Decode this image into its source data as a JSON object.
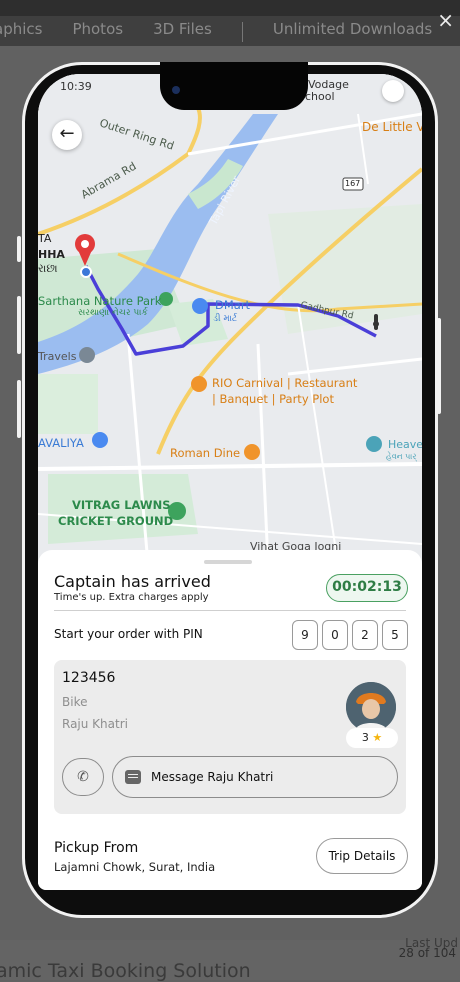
{
  "background_page": {
    "tabs": [
      "aphics",
      "Photos",
      "3D Files",
      "Unlimited Downloads"
    ],
    "close_symbol": "×",
    "counter": "28 of 104",
    "last_update": "Last Upd",
    "title_snippet": "amic Taxi Booking Solution"
  },
  "status": {
    "time": "10:39",
    "carrier_hint": "Vodage",
    "school_hint": "School"
  },
  "map": {
    "labels": {
      "outer_ring": "Outer Ring Rd",
      "abrama": "Abrama Rd",
      "tapi": "Tapi River",
      "de_little": "De Little V",
      "road_167": "167",
      "ta": "TA",
      "hha": "HHA",
      "guj_short": "રાછા",
      "park": "Sarthana Nature Park",
      "park_guj": "સરથાણા નેચર પાર્ક",
      "dmart": "DMart",
      "dmart_guj": "ડી માર્ટ",
      "gadhpur": "Gadhpur Rd",
      "travels": "Travels",
      "rio1": "RIO Carnival | Restaurant",
      "rio2": "| Banquet | Party Plot",
      "avaliya": "AVALIYA",
      "heaven": "Heave",
      "heaven_guj": "હેવન પાર્",
      "roman": "Roman Dine",
      "vitrag1": "VITRAG LAWNS",
      "vitrag2": "CRICKET GROUND",
      "vihat": "Vihat Goga Jogni"
    }
  },
  "sheet": {
    "arrived_title": "Captain has arrived",
    "arrived_sub": "Time's up. Extra charges apply",
    "timer": "00:02:13",
    "pin_label": "Start your order with PIN",
    "pin": [
      "9",
      "0",
      "2",
      "5"
    ],
    "vehicle_number": "123456",
    "vehicle_type": "Bike",
    "driver_name": "Raju Khatri",
    "rating": "3",
    "message_label": "Message Raju Khatri",
    "pickup_heading": "Pickup From",
    "pickup_value": "Lajamni Chowk, Surat, India",
    "trip_details": "Trip Details"
  },
  "colors": {
    "route": "#4a3fd8",
    "timer_green": "#2f7d45",
    "river": "#9bbdf0",
    "park": "#c9e7cf",
    "highway": "#f6cf65"
  }
}
